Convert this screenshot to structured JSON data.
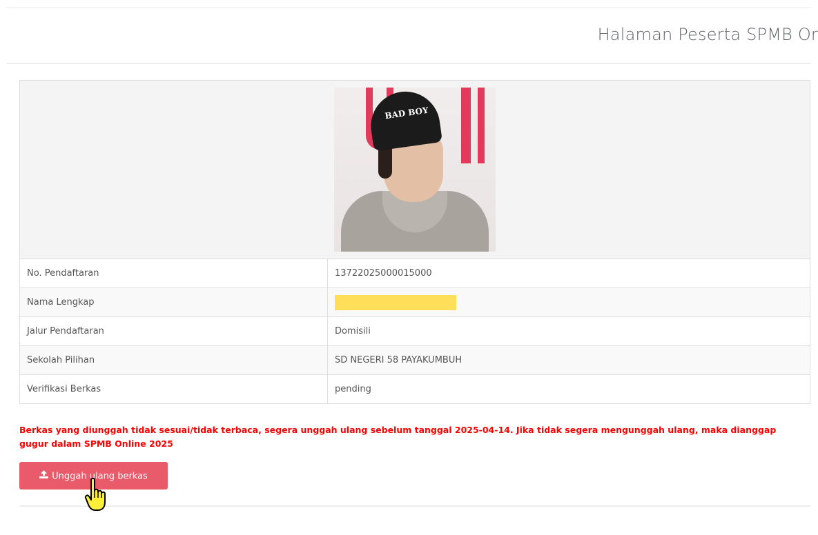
{
  "header": {
    "title": "Halaman Peserta SPMB Or"
  },
  "profile": {
    "photo_caption": "BAD BOY",
    "rows": [
      {
        "label": "No. Pendaftaran",
        "value": "13722025000015000"
      },
      {
        "label": "Nama Lengkap",
        "value": ""
      },
      {
        "label": "Jalur Pendaftaran",
        "value": "Domisili"
      },
      {
        "label": "Sekolah Pilihan",
        "value": "SD NEGERI 58 PAYAKUMBUH"
      },
      {
        "label": "Verifikasi Berkas",
        "value": "pending"
      }
    ]
  },
  "notice": {
    "text": "Berkas yang diunggah tidak sesuai/tidak terbaca, segera unggah ulang sebelum tanggal 2025-04-14. Jika tidak segera mengunggah ulang, maka dianggap gugur dalam SPMB Online 2025",
    "color": "#ff0000"
  },
  "actions": {
    "upload_label": "Unggah ulang berkas",
    "upload_icon": "upload-icon",
    "button_color": "#e95a6a"
  },
  "redaction_color": "#ffde59"
}
